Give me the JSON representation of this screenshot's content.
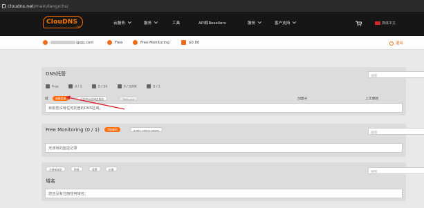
{
  "browser": {
    "url_host": "cloudns.net",
    "url_path": "/main/lang/chs/"
  },
  "nav": {
    "logo_text": "ClouDNS",
    "logo_sub": "net",
    "items": [
      {
        "label": "云服务",
        "dropdown": true
      },
      {
        "label": "服务",
        "dropdown": true
      },
      {
        "label": "工具",
        "dropdown": false
      },
      {
        "label": "API和Resellers",
        "dropdown": false
      },
      {
        "label": "服务",
        "dropdown": true
      },
      {
        "label": "客户支持",
        "dropdown": true
      }
    ],
    "lang": "简体中文"
  },
  "account": {
    "email_suffix": "@qq.com",
    "plan": "Free",
    "monitoring": "Free Monitoring",
    "balance": "$0.00",
    "logout": "退出"
  },
  "dns": {
    "title": "DNS托管",
    "stats": [
      {
        "icon": "plan-icon",
        "text": "Free"
      },
      {
        "icon": "zone-icon",
        "text": "0 / 1"
      },
      {
        "icon": "records-icon",
        "text": "0 / 50"
      },
      {
        "icon": "queries-icon",
        "text": "0 / 500K"
      },
      {
        "icon": "mail-forward-icon",
        "text": "0 / 1"
      }
    ],
    "search_placeholder": "搜索",
    "column_domain": "域",
    "column_created": "创建于",
    "column_last_update": "上次更新",
    "buttons": {
      "add_zone": "创建区域",
      "dyndns": "可用的动态域名服务",
      "tools": "Tools.pro"
    },
    "empty": "目前您没有任何托管的DNS区域。"
  },
  "monitoring": {
    "title": "Free Monitoring (0 / 1)",
    "add_button": "添加新的",
    "status_pages": "public status pages",
    "search_placeholder": "搜索",
    "empty": "无该何的监控记录"
  },
  "domains": {
    "title": "域名",
    "buttons": [
      "注册新域名",
      "转移",
      "续费",
      "价格"
    ],
    "search_placeholder": "搜索",
    "empty": "您还没有注册任何域名。"
  }
}
